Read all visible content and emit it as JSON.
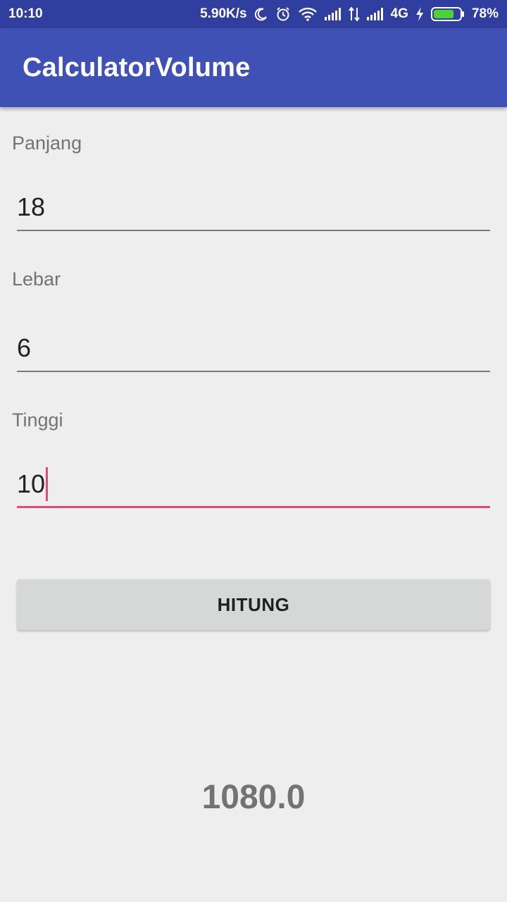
{
  "status_bar": {
    "time": "10:10",
    "network_speed": "5.90K/s",
    "network_type": "4G",
    "battery_percent": "78%",
    "battery_level": 0.78,
    "icons": [
      "moon-icon",
      "alarm-icon",
      "wifi-icon",
      "signal-icon",
      "data-arrows-icon",
      "signal-icon",
      "charging-icon",
      "battery-icon"
    ]
  },
  "app_bar": {
    "title": "CalculatorVolume"
  },
  "form": {
    "panjang": {
      "label": "Panjang",
      "value": "18"
    },
    "lebar": {
      "label": "Lebar",
      "value": "6"
    },
    "tinggi": {
      "label": "Tinggi",
      "value": "10"
    }
  },
  "button": {
    "label": "HITUNG"
  },
  "result": {
    "value": "1080.0"
  },
  "colors": {
    "status_bar": "#303f9f",
    "app_bar": "#3f51b5",
    "accent": "#e3497b",
    "background": "#eeeeee",
    "battery_fill": "#4cd137"
  }
}
